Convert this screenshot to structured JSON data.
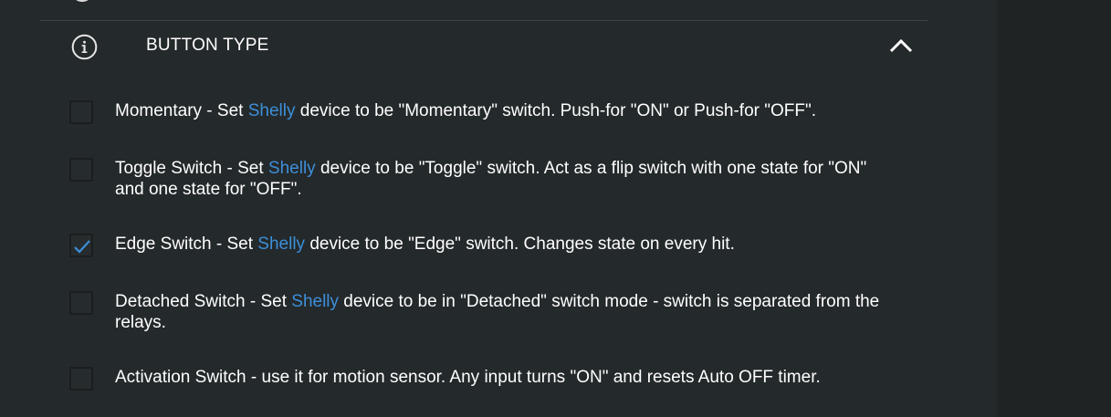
{
  "section": {
    "title": "BUTTON TYPE"
  },
  "colors": {
    "background": "#24292b",
    "brand_link": "#3d8fd8",
    "check": "#3d8fd8"
  },
  "options": [
    {
      "checked": false,
      "label_pre": "Momentary - Set ",
      "brand": "Shelly",
      "label_post": " device to be \"Momentary\" switch. Push-for \"ON\" or Push-for \"OFF\"."
    },
    {
      "checked": false,
      "label_pre": "Toggle Switch - Set ",
      "brand": "Shelly",
      "label_post": " device to be \"Toggle\" switch. Act as a flip switch with one state for \"ON\" and one state for \"OFF\"."
    },
    {
      "checked": true,
      "label_pre": "Edge Switch - Set ",
      "brand": "Shelly",
      "label_post": " device to be \"Edge\" switch. Changes state on every hit."
    },
    {
      "checked": false,
      "label_pre": "Detached Switch - Set ",
      "brand": "Shelly",
      "label_post": " device to be in \"Detached\" switch mode - switch is separated from the relays."
    },
    {
      "checked": false,
      "label_pre": "Activation Switch - use it for motion sensor. Any input turns \"ON\" and resets Auto OFF timer.",
      "brand": "",
      "label_post": ""
    }
  ]
}
